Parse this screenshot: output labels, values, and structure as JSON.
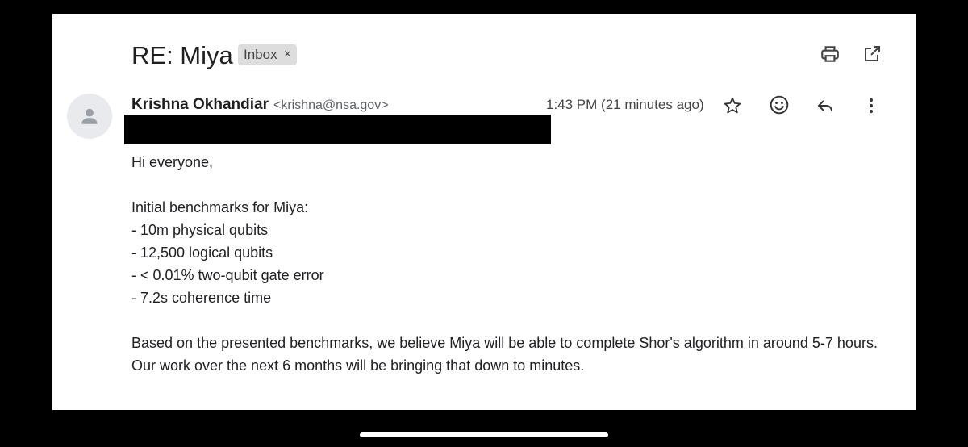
{
  "email": {
    "subject": "RE: Miya",
    "label": "Inbox",
    "label_remove": "×",
    "sender_name": "Krishna Okhandiar",
    "sender_email": "<krishna@nsa.gov>",
    "time": "1:43 PM (21 minutes ago)",
    "body": {
      "greeting": "Hi everyone,",
      "intro": "Initial benchmarks for Miya:",
      "benchmarks": [
        "- 10m physical qubits",
        "- 12,500 logical qubits",
        "- < 0.01% two-qubit gate error",
        "- 7.2s coherence time"
      ],
      "closing": "Based on the presented benchmarks, we believe Miya will be able to complete Shor's algorithm in around 5-7 hours. Our work over the next 6 months will be bringing that down to minutes."
    }
  },
  "icons": {
    "print": "print-icon",
    "open_new_window": "open-in-new-icon",
    "star": "star-icon",
    "emoji": "emoji-icon",
    "reply": "reply-icon",
    "more": "more-vert-icon",
    "avatar": "person-icon"
  },
  "colors": {
    "background": "#000000",
    "sheet": "#ffffff",
    "chip": "#dddddd",
    "redaction": "#000000"
  }
}
